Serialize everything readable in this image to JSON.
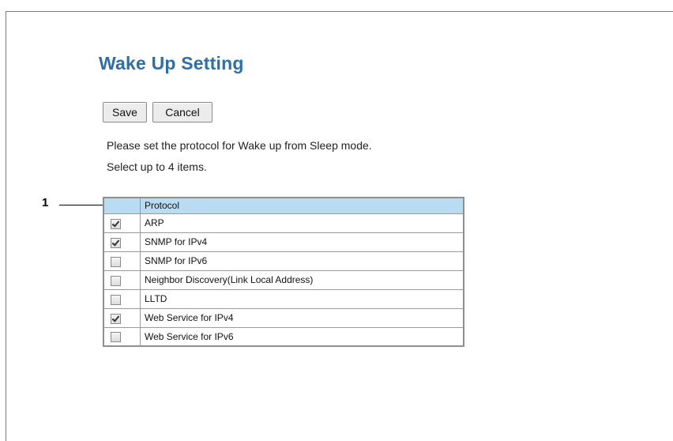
{
  "page": {
    "title": "Wake Up Setting",
    "instructions": [
      "Please set the protocol for Wake up from Sleep mode.",
      "Select up to 4 items."
    ],
    "callout": "1"
  },
  "toolbar": {
    "save_label": "Save",
    "cancel_label": "Cancel"
  },
  "table": {
    "header": "Protocol",
    "rows": [
      {
        "label": "ARP",
        "checked": true
      },
      {
        "label": "SNMP for IPv4",
        "checked": true
      },
      {
        "label": "SNMP for IPv6",
        "checked": false
      },
      {
        "label": "Neighbor Discovery(Link Local Address)",
        "checked": false
      },
      {
        "label": "LLTD",
        "checked": false
      },
      {
        "label": "Web Service for IPv4",
        "checked": true
      },
      {
        "label": "Web Service for IPv6",
        "checked": false
      }
    ]
  },
  "colors": {
    "title": "#2e6fa8",
    "header_bg": "#b9dcf2"
  }
}
